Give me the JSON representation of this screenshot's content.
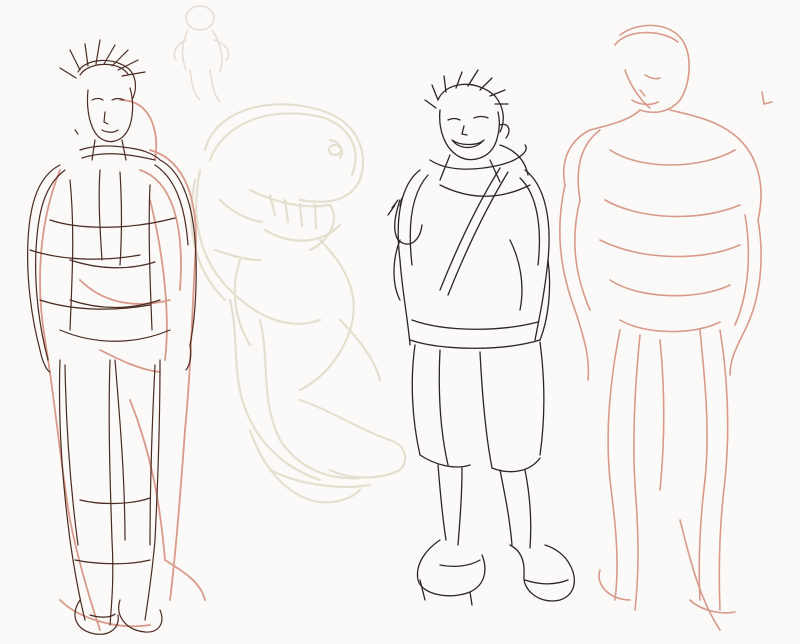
{
  "scene": {
    "background_color": "#fbfaf8",
    "colors": {
      "dark_ink": "#4a2a22",
      "black_ink": "#2a2626",
      "red_sketch": "#d89a8a",
      "beige_sketch": "#e4dfce",
      "ghost_sketch": "#e8ddd5"
    }
  }
}
